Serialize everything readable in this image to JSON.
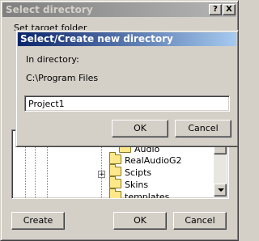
{
  "outer": {
    "title": "Select directory",
    "help_label": "?",
    "close_label": "X",
    "label_partial": "Set target folder",
    "tree_items": [
      "Audio",
      "RealAudioG2",
      "Scipts",
      "Skins",
      "templates"
    ],
    "create_label": "Create",
    "ok_label": "OK",
    "cancel_label": "Cancel"
  },
  "dialog": {
    "title": "Select/Create new directory",
    "in_directory_label": "In directory:",
    "path": "C:\\Program Files",
    "name_value": "Project1",
    "ok_label": "OK",
    "cancel_label": "Cancel"
  }
}
